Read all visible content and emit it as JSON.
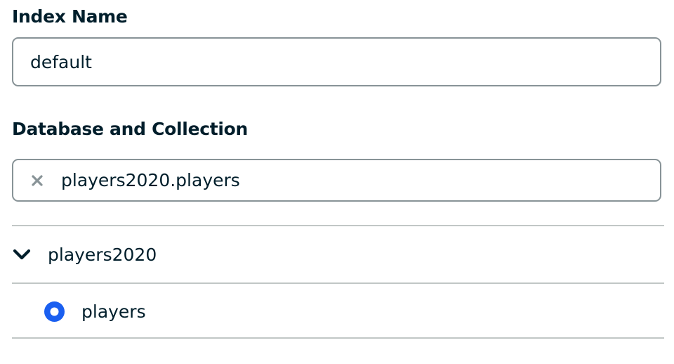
{
  "index_name": {
    "label": "Index Name",
    "value": "default"
  },
  "database_collection": {
    "label": "Database and Collection",
    "selected": "players2020.players",
    "clear_icon": "x-icon"
  },
  "tree": {
    "database": {
      "name": "players2020",
      "expanded": true,
      "icon": "chevron-down-icon"
    },
    "collections": [
      {
        "name": "players",
        "selected": true,
        "icon": "radio-selected-icon"
      }
    ]
  },
  "colors": {
    "text": "#001e2b",
    "input_border": "#889397",
    "divider": "#c1c7c6",
    "accent_blue": "#1a5ff0",
    "clear_icon": "#889397"
  }
}
